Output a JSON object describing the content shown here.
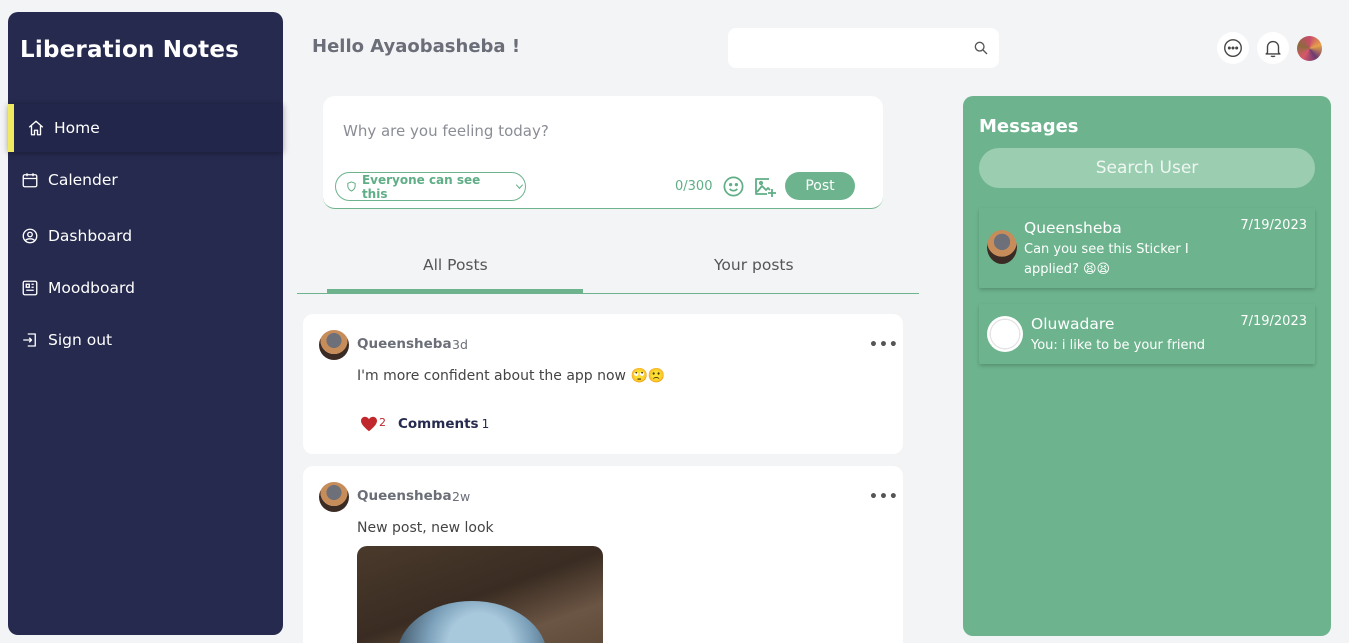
{
  "sidebar": {
    "brand": "Liberation Notes",
    "items": [
      {
        "label": "Home",
        "icon": "home-icon"
      },
      {
        "label": "Calender",
        "icon": "calendar-icon"
      },
      {
        "label": "Dashboard",
        "icon": "user-circle-icon"
      },
      {
        "label": "Moodboard",
        "icon": "moodboard-icon"
      },
      {
        "label": "Sign out",
        "icon": "sign-out-icon"
      }
    ]
  },
  "header": {
    "greeting": "Hello Ayaobasheba !",
    "search_value": ""
  },
  "composer": {
    "placeholder": "Why are you feeling today?",
    "visibility": "Everyone can see this",
    "counter": "0/300",
    "post_label": "Post"
  },
  "tabs": [
    {
      "label": "All Posts",
      "active": true
    },
    {
      "label": "Your posts",
      "active": false
    }
  ],
  "posts": [
    {
      "author": "Queensheba",
      "time": "3d",
      "text": "I'm more confident about the app now 🙄🙁",
      "likes": "2",
      "comments_label": "Comments",
      "comments_count": "1"
    },
    {
      "author": "Queensheba",
      "time": "2w",
      "text": "New post, new look"
    }
  ],
  "messages": {
    "title": "Messages",
    "search_label": "Search User",
    "items": [
      {
        "name": "Queensheba",
        "date": "7/19/2023",
        "preview": "Can you see this Sticker I applied? 😫😫"
      },
      {
        "name": "Oluwadare",
        "date": "7/19/2023",
        "preview": "You: i like to be your friend"
      }
    ]
  },
  "colors": {
    "sidebar": "#262a4e",
    "accent": "#6db48e",
    "active_marker": "#f0ea60",
    "like": "#c0282d"
  }
}
